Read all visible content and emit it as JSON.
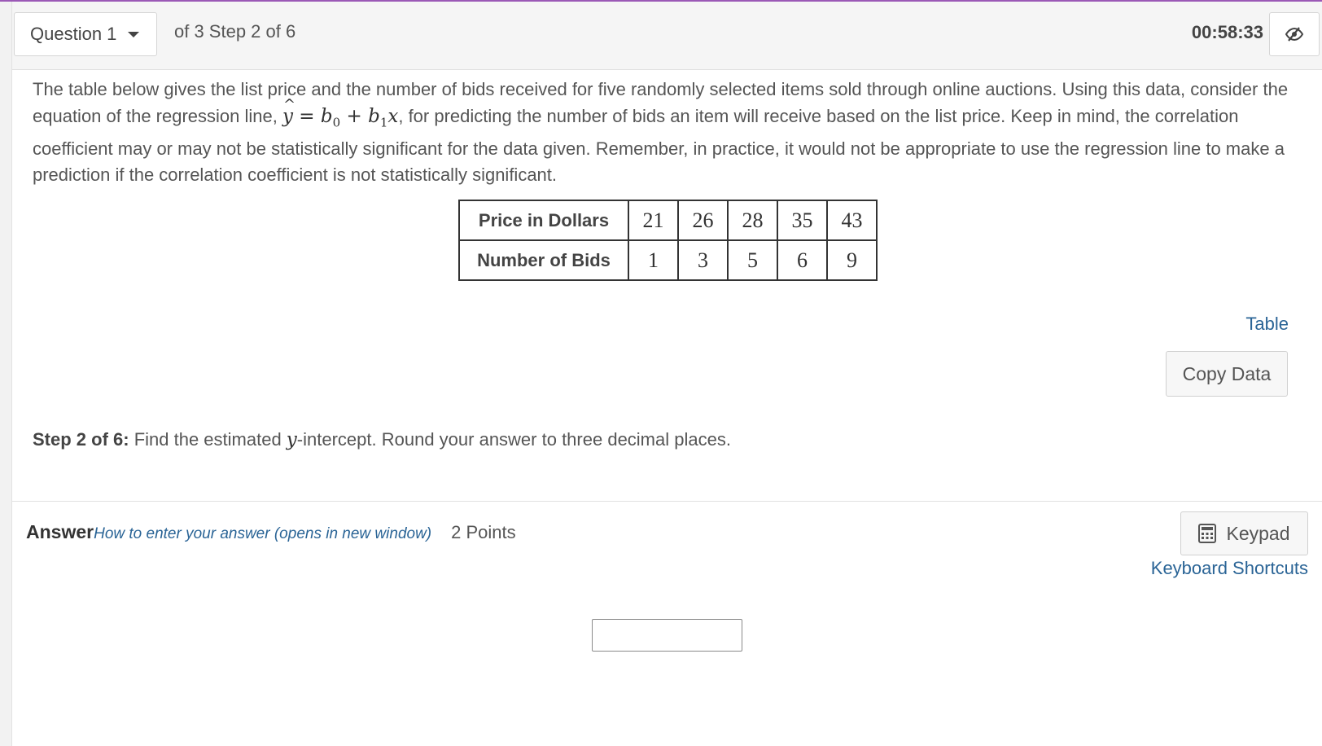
{
  "header": {
    "question_select": "Question 1",
    "step_info": "of 3 Step 2 of 6",
    "timer": "00:58:33",
    "visibility_icon": "eye-slash-icon"
  },
  "question": {
    "part1": "The table below gives the list price and the number of bids received for five randomly selected items sold through online auctions. Using this data, consider the equation of the regression line, ",
    "eq_y": "y",
    "eq_eq": " = ",
    "eq_b0": "b",
    "eq_sub0": "0",
    "eq_plus": " + ",
    "eq_b1": "b",
    "eq_sub1": "1",
    "eq_x": "x",
    "part2": ", for predicting the number of bids an item will receive based on the list price. Keep in mind, the correlation coefficient may or may not be statistically significant for the data given. Remember, in practice, it would not be appropriate to use the regression line to make a prediction if the correlation coefficient is not statistically significant."
  },
  "table": {
    "row1_label": "Price in Dollars",
    "row1_values": [
      "21",
      "26",
      "28",
      "35",
      "43"
    ],
    "row2_label": "Number of Bids",
    "row2_values": [
      "1",
      "3",
      "5",
      "6",
      "9"
    ]
  },
  "tools": {
    "table_link": "Table",
    "copy_data": "Copy Data"
  },
  "step": {
    "label": "Step 2 of 6:",
    "text_before": " Find the estimated ",
    "var": "y",
    "text_after": "-intercept. Round your answer to three decimal places."
  },
  "answer": {
    "label": "Answer",
    "how_link": "How to enter your answer (opens in new window)",
    "points": "2 Points",
    "keypad": "Keypad",
    "keypad_icon": "calculator-icon",
    "shortcuts": "Keyboard Shortcuts",
    "input_value": ""
  },
  "colors": {
    "accent": "#9b59b6",
    "link": "#2a6496"
  }
}
